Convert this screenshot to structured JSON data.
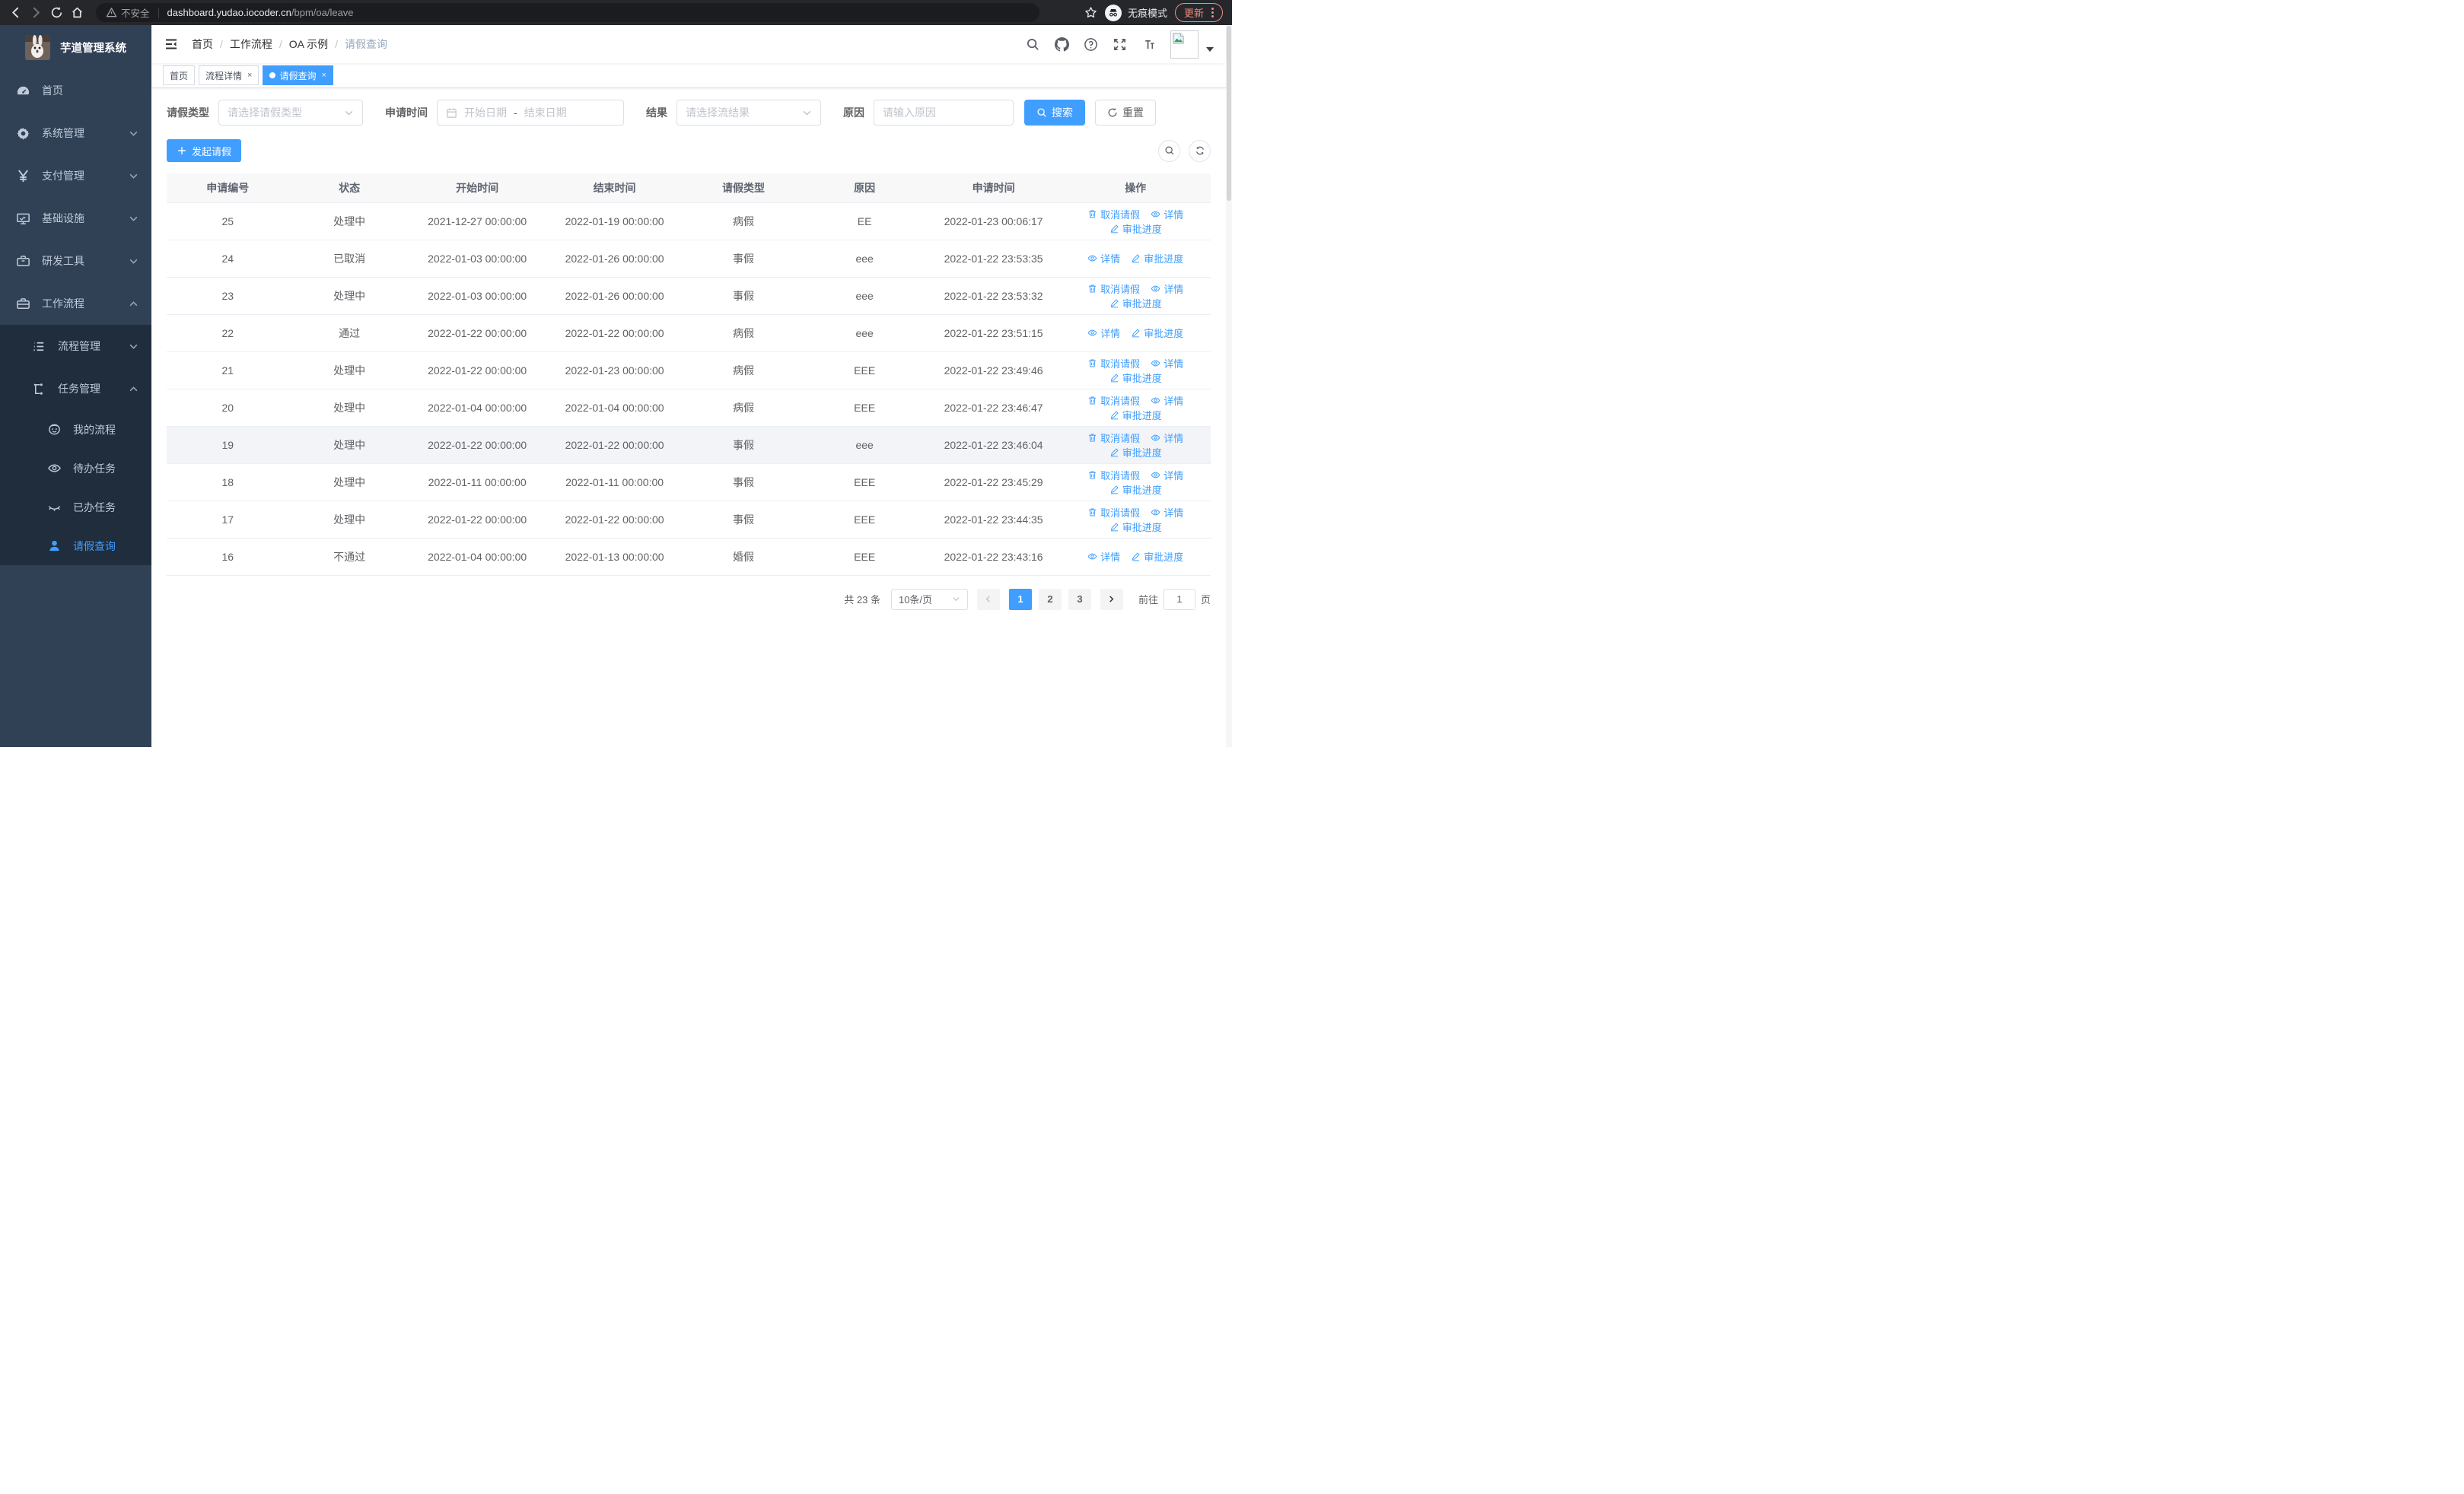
{
  "browser": {
    "security_label": "不安全",
    "url_host": "dashboard.yudao.iocoder.cn",
    "url_path": "/bpm/oa/leave",
    "incognito_label": "无痕模式",
    "update_label": "更新"
  },
  "sidebar": {
    "title": "芋道管理系统",
    "items": [
      {
        "label": "首页"
      },
      {
        "label": "系统管理"
      },
      {
        "label": "支付管理"
      },
      {
        "label": "基础设施"
      },
      {
        "label": "研发工具"
      },
      {
        "label": "工作流程"
      }
    ],
    "level2": [
      {
        "label": "流程管理"
      },
      {
        "label": "任务管理"
      }
    ],
    "level3": [
      {
        "label": "我的流程"
      },
      {
        "label": "待办任务"
      },
      {
        "label": "已办任务"
      },
      {
        "label": "请假查询"
      }
    ]
  },
  "header": {
    "breadcrumb": [
      "首页",
      "工作流程",
      "OA 示例",
      "请假查询"
    ]
  },
  "tags": [
    {
      "label": "首页",
      "closable": false,
      "active": false
    },
    {
      "label": "流程详情",
      "closable": true,
      "active": false
    },
    {
      "label": "请假查询",
      "closable": true,
      "active": true
    }
  ],
  "filters": {
    "leave_type_label": "请假类型",
    "leave_type_placeholder": "请选择请假类型",
    "apply_time_label": "申请时间",
    "date_start_placeholder": "开始日期",
    "date_separator": "-",
    "date_end_placeholder": "结束日期",
    "result_label": "结果",
    "result_placeholder": "请选择流结果",
    "reason_label": "原因",
    "reason_placeholder": "请输入原因",
    "search_label": "搜索",
    "reset_label": "重置"
  },
  "toolbar": {
    "create_label": "发起请假"
  },
  "table": {
    "headers": [
      "申请编号",
      "状态",
      "开始时间",
      "结束时间",
      "请假类型",
      "原因",
      "申请时间",
      "操作"
    ],
    "action_labels": {
      "cancel": "取消请假",
      "detail": "详情",
      "progress": "审批进度"
    },
    "rows": [
      {
        "id": "25",
        "status": "处理中",
        "start": "2021-12-27 00:00:00",
        "end": "2022-01-19 00:00:00",
        "type": "病假",
        "reason": "EE",
        "applyTime": "2022-01-23 00:06:17",
        "cancel": true,
        "hover": false
      },
      {
        "id": "24",
        "status": "已取消",
        "start": "2022-01-03 00:00:00",
        "end": "2022-01-26 00:00:00",
        "type": "事假",
        "reason": "eee",
        "applyTime": "2022-01-22 23:53:35",
        "cancel": false,
        "hover": false
      },
      {
        "id": "23",
        "status": "处理中",
        "start": "2022-01-03 00:00:00",
        "end": "2022-01-26 00:00:00",
        "type": "事假",
        "reason": "eee",
        "applyTime": "2022-01-22 23:53:32",
        "cancel": true,
        "hover": false
      },
      {
        "id": "22",
        "status": "通过",
        "start": "2022-01-22 00:00:00",
        "end": "2022-01-22 00:00:00",
        "type": "病假",
        "reason": "eee",
        "applyTime": "2022-01-22 23:51:15",
        "cancel": false,
        "hover": false
      },
      {
        "id": "21",
        "status": "处理中",
        "start": "2022-01-22 00:00:00",
        "end": "2022-01-23 00:00:00",
        "type": "病假",
        "reason": "EEE",
        "applyTime": "2022-01-22 23:49:46",
        "cancel": true,
        "hover": false
      },
      {
        "id": "20",
        "status": "处理中",
        "start": "2022-01-04 00:00:00",
        "end": "2022-01-04 00:00:00",
        "type": "病假",
        "reason": "EEE",
        "applyTime": "2022-01-22 23:46:47",
        "cancel": true,
        "hover": false
      },
      {
        "id": "19",
        "status": "处理中",
        "start": "2022-01-22 00:00:00",
        "end": "2022-01-22 00:00:00",
        "type": "事假",
        "reason": "eee",
        "applyTime": "2022-01-22 23:46:04",
        "cancel": true,
        "hover": true
      },
      {
        "id": "18",
        "status": "处理中",
        "start": "2022-01-11 00:00:00",
        "end": "2022-01-11 00:00:00",
        "type": "事假",
        "reason": "EEE",
        "applyTime": "2022-01-22 23:45:29",
        "cancel": true,
        "hover": false
      },
      {
        "id": "17",
        "status": "处理中",
        "start": "2022-01-22 00:00:00",
        "end": "2022-01-22 00:00:00",
        "type": "事假",
        "reason": "EEE",
        "applyTime": "2022-01-22 23:44:35",
        "cancel": true,
        "hover": false
      },
      {
        "id": "16",
        "status": "不通过",
        "start": "2022-01-04 00:00:00",
        "end": "2022-01-13 00:00:00",
        "type": "婚假",
        "reason": "EEE",
        "applyTime": "2022-01-22 23:43:16",
        "cancel": false,
        "hover": false
      }
    ]
  },
  "pagination": {
    "total_label": "共 23 条",
    "page_size_label": "10条/页",
    "pages": [
      "1",
      "2",
      "3"
    ],
    "active_page": "1",
    "goto_label": "前往",
    "goto_value": "1",
    "page_suffix": "页"
  },
  "colors": {
    "accent": "#409eff",
    "sidebar_bg": "#304156",
    "submenu_bg": "#1f2d3d",
    "update_pill": "#f28b82"
  }
}
